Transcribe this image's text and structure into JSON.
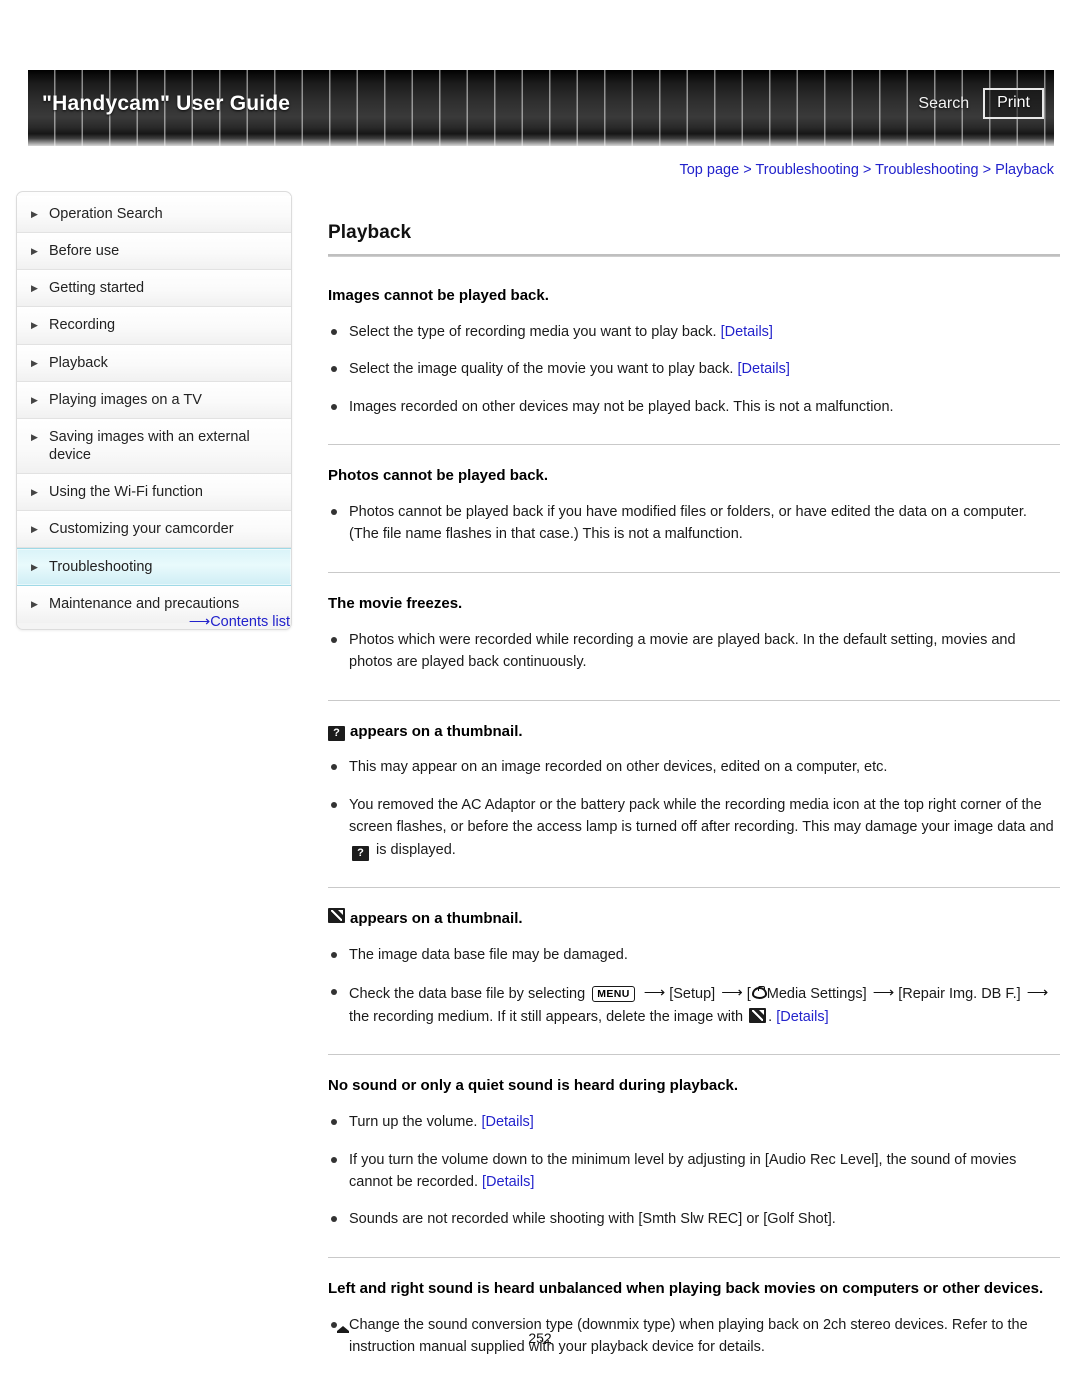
{
  "header": {
    "title": "\"Handycam\" User Guide",
    "search_label": "Search",
    "print_label": "Print"
  },
  "breadcrumb": {
    "items": [
      "Top page",
      "Troubleshooting",
      "Troubleshooting",
      "Playback"
    ],
    "separator": ">"
  },
  "sidebar": {
    "items": [
      {
        "label": "Operation Search",
        "active": false
      },
      {
        "label": "Before use",
        "active": false
      },
      {
        "label": "Getting started",
        "active": false
      },
      {
        "label": "Recording",
        "active": false
      },
      {
        "label": "Playback",
        "active": false
      },
      {
        "label": "Playing images on a TV",
        "active": false
      },
      {
        "label": "Saving images with an external device",
        "active": false
      },
      {
        "label": "Using the Wi-Fi function",
        "active": false
      },
      {
        "label": "Customizing your camcorder",
        "active": false
      },
      {
        "label": "Troubleshooting",
        "active": true
      },
      {
        "label": "Maintenance and precautions",
        "active": false
      }
    ],
    "contents_list_label": "Contents list"
  },
  "main": {
    "page_title": "Playback",
    "sections": [
      {
        "id": "images-cannot-be-played-back",
        "heading": "Images cannot be played back.",
        "bullets": [
          {
            "text": "Select the type of recording media you want to play back. ",
            "link": "[Details]"
          },
          {
            "text": "Select the image quality of the movie you want to play back. ",
            "link": "[Details]"
          },
          {
            "text": "Images recorded on other devices may not be played back. This is not a malfunction.",
            "link": ""
          }
        ]
      },
      {
        "id": "photos-cannot-be-played-back",
        "heading": "Photos cannot be played back.",
        "bullets": [
          {
            "text": "Photos cannot be played back if you have modified files or folders, or have edited the data on a computer. (The file name flashes in that case.) This is not a malfunction.",
            "link": ""
          }
        ]
      },
      {
        "id": "the-movie-freezes",
        "heading": "The movie freezes.",
        "bullets": [
          {
            "text": "Photos which were recorded while recording a movie are played back. In the default setting, movies and photos are played back continuously.",
            "link": ""
          }
        ]
      },
      {
        "id": "question-icon-thumbnail",
        "heading_icon": "question-mark-icon",
        "heading": "appears on a thumbnail.",
        "bullets": [
          {
            "text": "This may appear on an image recorded on other devices, edited on a computer, etc.",
            "link": ""
          }
        ]
      },
      {
        "id": "broken-icon-thumbnail",
        "heading_icon": "broken-image-icon",
        "heading": "appears on a thumbnail.",
        "bullets": [
          {
            "text": "The image data base file may be damaged.",
            "link": ""
          }
        ]
      },
      {
        "id": "no-sound",
        "heading": "No sound or only a quiet sound is heard during playback.",
        "bullets": [
          {
            "text": "Turn up the volume. ",
            "link": "[Details]"
          },
          {
            "text": "If you turn the volume down to the minimum level by adjusting in [Audio Rec Level], the sound of movies cannot be recorded. ",
            "link": "[Details]"
          },
          {
            "text": "Sounds are not recorded while shooting with [Smth Slw REC] or [Golf Shot].",
            "link": ""
          }
        ]
      },
      {
        "id": "left-right-unbalanced",
        "heading": "Left and right sound is heard unbalanced when playing back movies on computers or other devices.",
        "bullets": [
          {
            "text": "Change the sound conversion type (downmix type) when playing back on 2ch stereo devices. Refer to the instruction manual supplied with your playback device for details.",
            "link": ""
          }
        ]
      }
    ],
    "ac_adaptor_bullet": {
      "part1": "You removed the AC Adaptor or the battery pack while the recording media icon at the top right corner of the screen flashes, or before the access lamp is turned off after recording. This may damage your image data and ",
      "part2": " is displayed."
    },
    "db_check_bullet": {
      "p1": "Check the data base file by selecting ",
      "menu_label": "MENU",
      "p2": "[Setup]",
      "p3_open": "[",
      "p3": "Media Settings]",
      "p4": "[Repair Img. DB F.]",
      "p5": "the recording medium. If it still appears, delete the image with ",
      "p6": ". ",
      "link": "[Details]"
    }
  },
  "footer": {
    "page_number": "252"
  },
  "colors": {
    "link": "#2222cc",
    "active_nav": "#d9f3f8",
    "header_dark": "#2a2a2a"
  }
}
